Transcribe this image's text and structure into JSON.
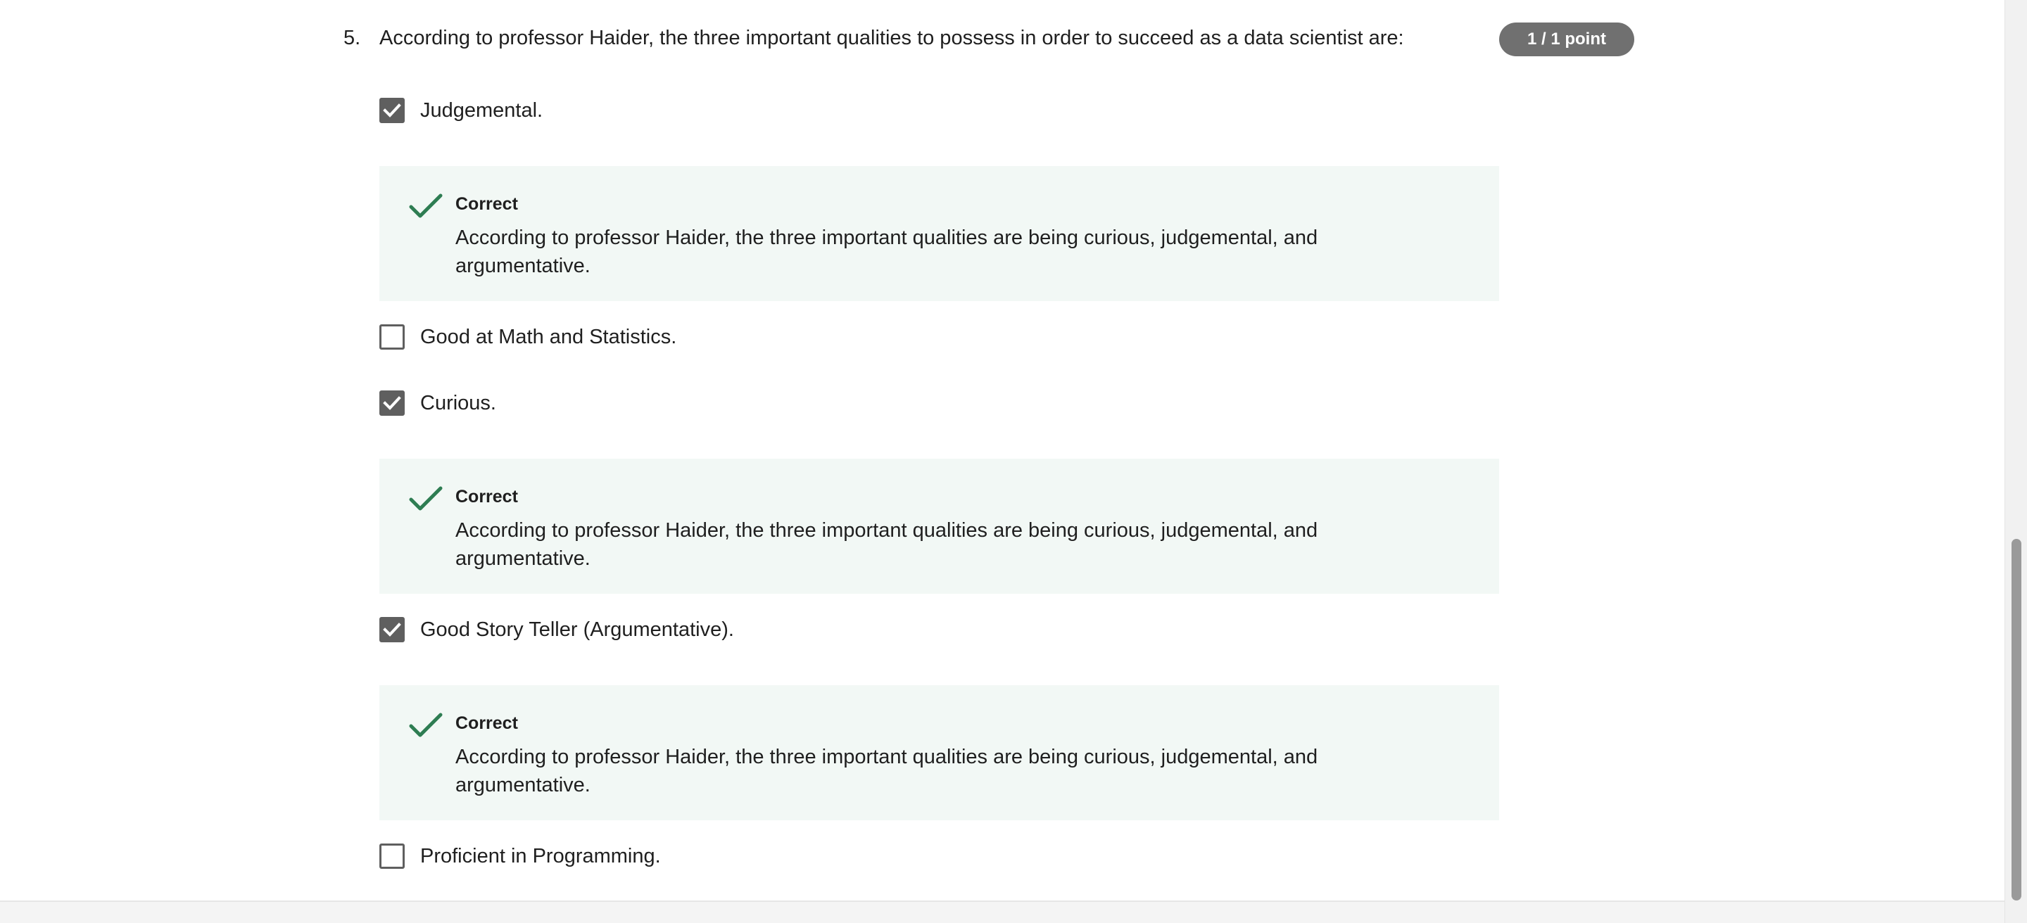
{
  "question": {
    "number": "5.",
    "text": "According to professor Haider, the three important qualities to possess in order to succeed as a data scientist are:",
    "score": "1 / 1 point"
  },
  "options": [
    {
      "label": "Judgemental.",
      "checked": true
    },
    {
      "label": "Good at Math and Statistics.",
      "checked": false
    },
    {
      "label": "Curious.",
      "checked": true
    },
    {
      "label": "Good Story Teller (Argumentative).",
      "checked": true
    },
    {
      "label": "Proficient in Programming.",
      "checked": false
    }
  ],
  "feedback": [
    {
      "title": "Correct",
      "text": "According to professor Haider, the three important qualities are being curious, judgemental, and argumentative."
    },
    {
      "title": "Correct",
      "text": "According to professor Haider, the three important qualities are being curious, judgemental, and argumentative."
    },
    {
      "title": "Correct",
      "text": "According to professor Haider, the three important qualities are being curious, judgemental, and argumentative."
    }
  ],
  "colors": {
    "badge": "#707070",
    "feedback_bg": "#f2f8f5",
    "correct_check": "#2e7d52",
    "checkbox": "#5f5f5f"
  },
  "icons": {
    "checked_box": "checkbox-checked-icon",
    "unchecked_box": "checkbox-unchecked-icon",
    "correct": "checkmark-icon"
  }
}
